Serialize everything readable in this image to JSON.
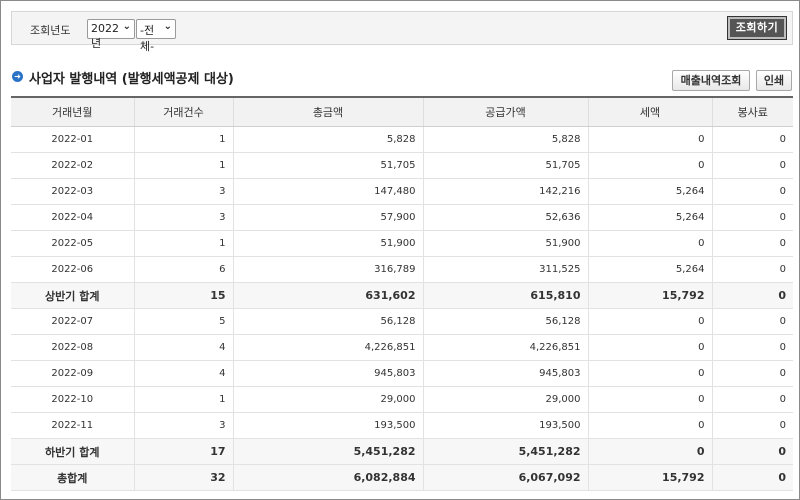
{
  "filter": {
    "label": "조회년도",
    "year": "2022년",
    "type": "-전체-",
    "search_button": "조회하기"
  },
  "section": {
    "title": "사업자 발행내역 (발행세액공제 대상)",
    "sales_button": "매출내역조회",
    "print_button": "인쇄"
  },
  "table": {
    "headers": [
      "거래년월",
      "거래건수",
      "총금액",
      "공급가액",
      "세액",
      "봉사료"
    ],
    "rows": [
      {
        "type": "data",
        "cells": [
          "2022-01",
          "1",
          "5,828",
          "5,828",
          "0",
          "0"
        ]
      },
      {
        "type": "data",
        "cells": [
          "2022-02",
          "1",
          "51,705",
          "51,705",
          "0",
          "0"
        ]
      },
      {
        "type": "data",
        "cells": [
          "2022-03",
          "3",
          "147,480",
          "142,216",
          "5,264",
          "0"
        ]
      },
      {
        "type": "data",
        "cells": [
          "2022-04",
          "3",
          "57,900",
          "52,636",
          "5,264",
          "0"
        ]
      },
      {
        "type": "data",
        "cells": [
          "2022-05",
          "1",
          "51,900",
          "51,900",
          "0",
          "0"
        ]
      },
      {
        "type": "data",
        "cells": [
          "2022-06",
          "6",
          "316,789",
          "311,525",
          "5,264",
          "0"
        ]
      },
      {
        "type": "total",
        "cells": [
          "상반기 합계",
          "15",
          "631,602",
          "615,810",
          "15,792",
          "0"
        ]
      },
      {
        "type": "data",
        "cells": [
          "2022-07",
          "5",
          "56,128",
          "56,128",
          "0",
          "0"
        ]
      },
      {
        "type": "data",
        "cells": [
          "2022-08",
          "4",
          "4,226,851",
          "4,226,851",
          "0",
          "0"
        ]
      },
      {
        "type": "data",
        "cells": [
          "2022-09",
          "4",
          "945,803",
          "945,803",
          "0",
          "0"
        ]
      },
      {
        "type": "data",
        "cells": [
          "2022-10",
          "1",
          "29,000",
          "29,000",
          "0",
          "0"
        ]
      },
      {
        "type": "data",
        "cells": [
          "2022-11",
          "3",
          "193,500",
          "193,500",
          "0",
          "0"
        ]
      },
      {
        "type": "total",
        "cells": [
          "하반기 합계",
          "17",
          "5,451,282",
          "5,451,282",
          "0",
          "0"
        ]
      },
      {
        "type": "total",
        "cells": [
          "총합계",
          "32",
          "6,082,884",
          "6,067,092",
          "15,792",
          "0"
        ]
      }
    ]
  }
}
